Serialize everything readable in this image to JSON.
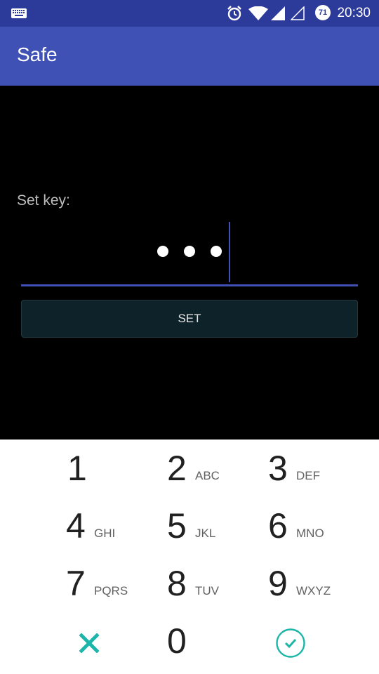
{
  "status_bar": {
    "time": "20:30",
    "battery_level": "71",
    "icons": [
      "keyboard-icon",
      "alarm-icon",
      "wifi-icon",
      "cell-signal-icon",
      "cell-signal-empty-icon",
      "battery-icon"
    ]
  },
  "app_bar": {
    "title": "Safe"
  },
  "form": {
    "label": "Set key:",
    "entered_length": 3,
    "set_button_label": "SET"
  },
  "keypad": {
    "keys": [
      {
        "digit": "1",
        "letters": ""
      },
      {
        "digit": "2",
        "letters": "ABC"
      },
      {
        "digit": "3",
        "letters": "DEF"
      },
      {
        "digit": "4",
        "letters": "GHI"
      },
      {
        "digit": "5",
        "letters": "JKL"
      },
      {
        "digit": "6",
        "letters": "MNO"
      },
      {
        "digit": "7",
        "letters": "PQRS"
      },
      {
        "digit": "8",
        "letters": "TUV"
      },
      {
        "digit": "9",
        "letters": "WXYZ"
      },
      {
        "digit": "0",
        "letters": ""
      }
    ],
    "cancel_icon": "close-icon",
    "confirm_icon": "check-circle-icon"
  },
  "colors": {
    "status_bar": "#2c3a99",
    "app_bar": "#3f51b5",
    "accent": "#3f51b5",
    "keypad_action": "#1cb5a9"
  }
}
